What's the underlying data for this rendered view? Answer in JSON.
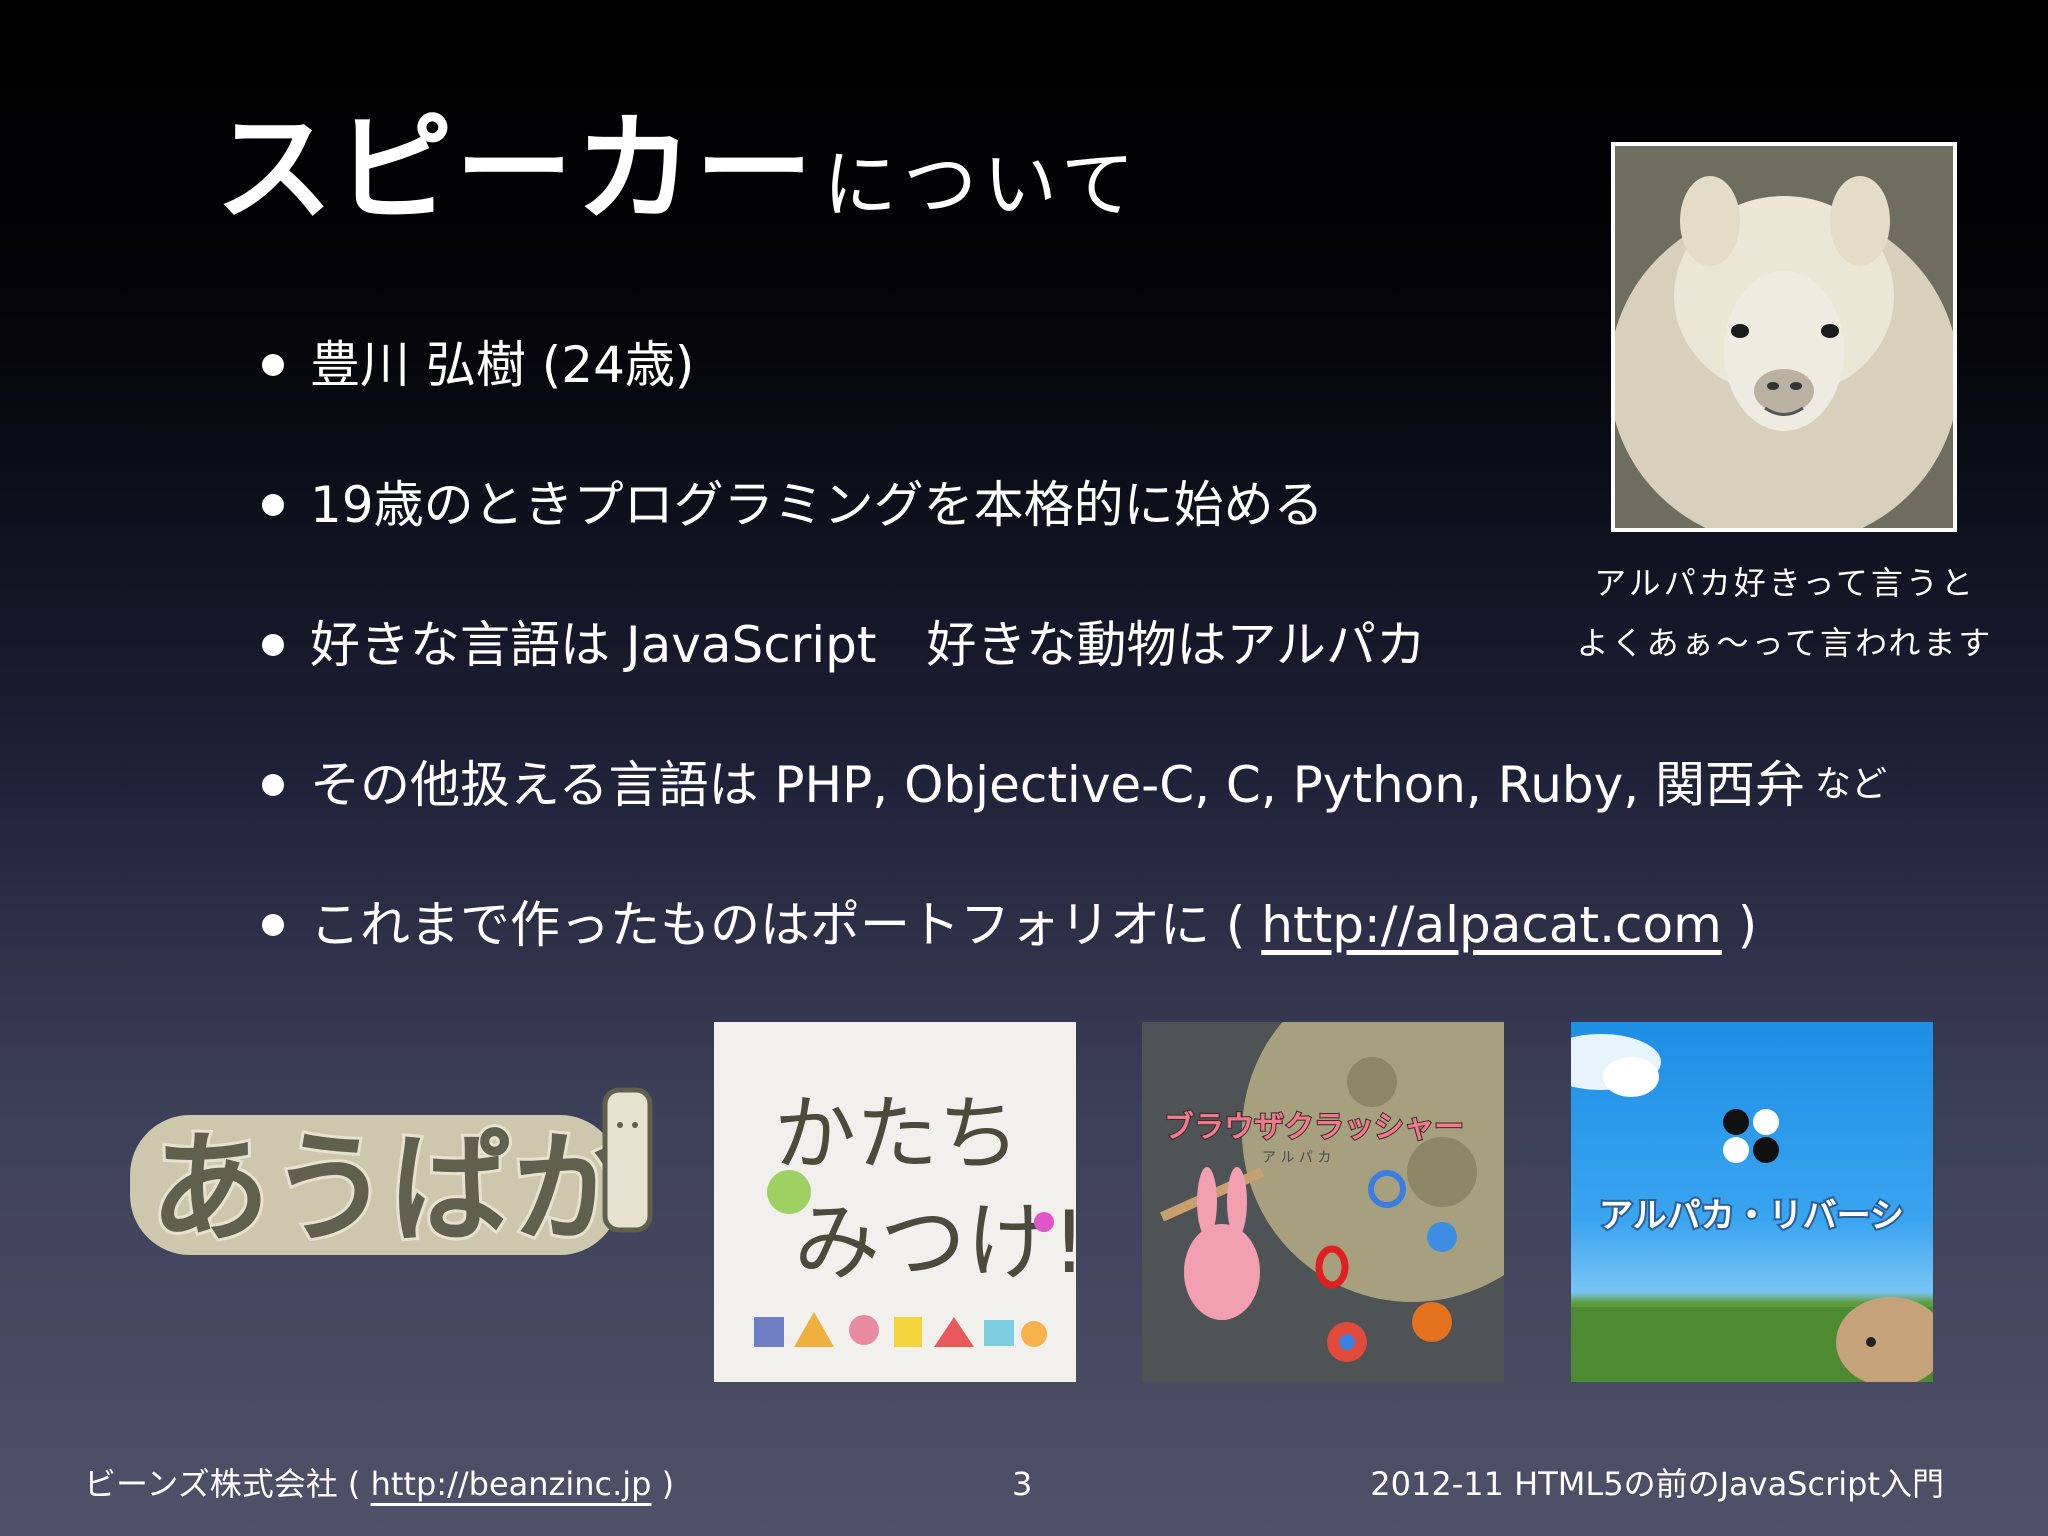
{
  "slide": {
    "title_main": "スピーカー",
    "title_sub": "について",
    "bullets": [
      {
        "text": "豊川 弘樹 (24歳)"
      },
      {
        "text": "19歳のときプログラミングを本格的に始める"
      },
      {
        "text": "好きな言語は JavaScript　好きな動物はアルパカ"
      },
      {
        "text": "その他扱える言語は PHP, Objective-C, C, Python, Ruby, 関西弁",
        "suffix": "など"
      },
      {
        "text_before": "これまで作ったものはポートフォリオに ( ",
        "link": "http://alpacat.com",
        "text_after": " )"
      }
    ],
    "photo_caption_line1": "アルパカ好きって言うと",
    "photo_caption_line2": "よくあぁ〜って言われます",
    "portfolio": {
      "aupaka_logo_text": "あうぱか",
      "katachi_title_line1": "かたち",
      "katachi_title_line2": "みつけ!!",
      "crasher_title": "ブラウザクラッシャー",
      "crasher_subtitle": "ア ル パ カ",
      "reversi_title": "アルパカ・リバーシ"
    }
  },
  "footer": {
    "company": "ビーンズ株式会社 ( ",
    "company_link": "http://beanzinc.jp",
    "company_close": " )",
    "page_number": "3",
    "event": "2012-11 HTML5の前のJavaScript入門"
  },
  "colors": {
    "background_top": "#000000",
    "background_bottom": "#4f5168",
    "text": "#ffffff"
  }
}
